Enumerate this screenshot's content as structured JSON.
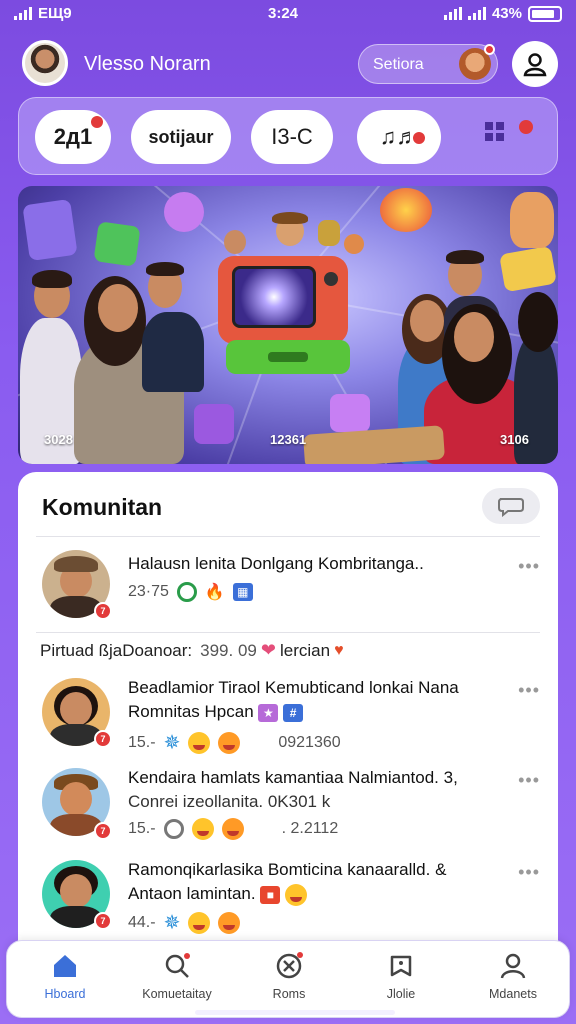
{
  "status_bar": {
    "carrier": "EЩ9",
    "time": "3:24",
    "battery": "43%"
  },
  "header": {
    "username": "Vlesso Norarn",
    "settings_label": "Setiora"
  },
  "quick_actions": [
    {
      "label": "2д1",
      "icon": "badge-icon"
    },
    {
      "label": "sotijaur",
      "icon": "chat-bubble-icon"
    },
    {
      "label": "I3-C",
      "icon": "number-icon"
    },
    {
      "label": "♫♬",
      "icon": "music-icon"
    }
  ],
  "hero": {
    "labels": [
      "3028",
      "12361",
      "3106"
    ]
  },
  "community": {
    "title": "Komunitan",
    "featured": {
      "text": "Halausn lenita Donlgang Kombritanga..",
      "meta": "23·75"
    },
    "subline": {
      "text1": "Pirtuad ßjaDoanoar:",
      "count": "399. 09",
      "text2": "lercian"
    },
    "posts": [
      {
        "line1": "Beadlamior Tiraol Kemubticand lonkai Nana",
        "line2": "Romnitas Hpcan",
        "likes": "15.-",
        "stat": "0921360"
      },
      {
        "line1": "Kendaira hamlats kamantiaa Nalmiantod. 3,",
        "line2": "Conrei izeollanita. 0K301 k",
        "likes": "15.-",
        "stat": ". 2.2112"
      },
      {
        "line1": "Ramonqikarlasika Bomticina kanaaralld. &",
        "line2": "Antaon lamintan.",
        "likes": "44.-"
      }
    ]
  },
  "bottom_nav": [
    {
      "label": "Hboard",
      "icon": "home-icon",
      "active": true
    },
    {
      "label": "Komuetaitay",
      "icon": "search-icon",
      "active": false
    },
    {
      "label": "Roms",
      "icon": "tools-icon",
      "active": false
    },
    {
      "label": "Jlolie",
      "icon": "bell-icon",
      "active": false
    },
    {
      "label": "Mdanets",
      "icon": "person-icon",
      "active": false
    }
  ],
  "colors": {
    "accent": "#7c4be0",
    "active_nav": "#3b6fd8",
    "badge": "#e23a3a"
  }
}
